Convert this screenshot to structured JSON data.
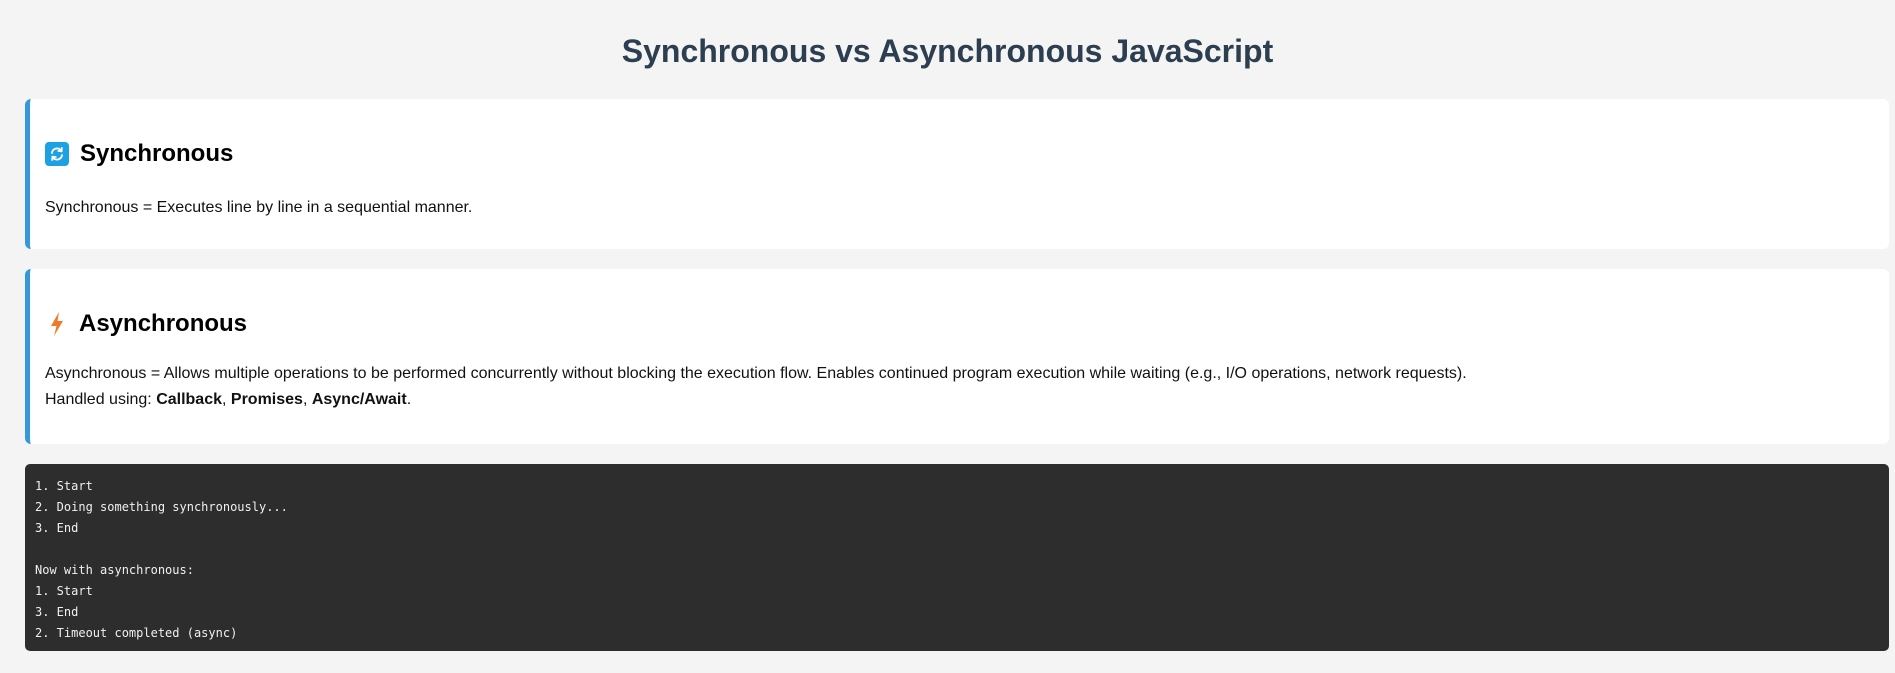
{
  "page": {
    "title": "Synchronous vs Asynchronous JavaScript"
  },
  "sync_card": {
    "icon": "sync-arrows-icon",
    "title": "Synchronous",
    "description": "Synchronous = Executes line by line in a sequential manner."
  },
  "async_card": {
    "icon": "lightning-bolt-icon",
    "title": "Asynchronous",
    "description": "Asynchronous = Allows multiple operations to be performed concurrently without blocking the execution flow. Enables continued program execution while waiting (e.g., I/O operations, network requests).",
    "handled_prefix": "Handled using: ",
    "handled_items": [
      "Callback",
      "Promises",
      "Async/Await"
    ],
    "separator": ", ",
    "suffix": "."
  },
  "console_output": {
    "lines": [
      "1. Start",
      "2. Doing something synchronously...",
      "3. End",
      "",
      "Now with asynchronous:",
      "1. Start",
      "3. End",
      "2. Timeout completed (async)"
    ]
  },
  "colors": {
    "title": "#2c3e50",
    "card_accent": "#3498db",
    "sync_icon_bg": "#1da1e2",
    "bolt_icon": "#f07a28",
    "console_bg": "#2d2d2d",
    "page_bg": "#f4f4f4"
  }
}
